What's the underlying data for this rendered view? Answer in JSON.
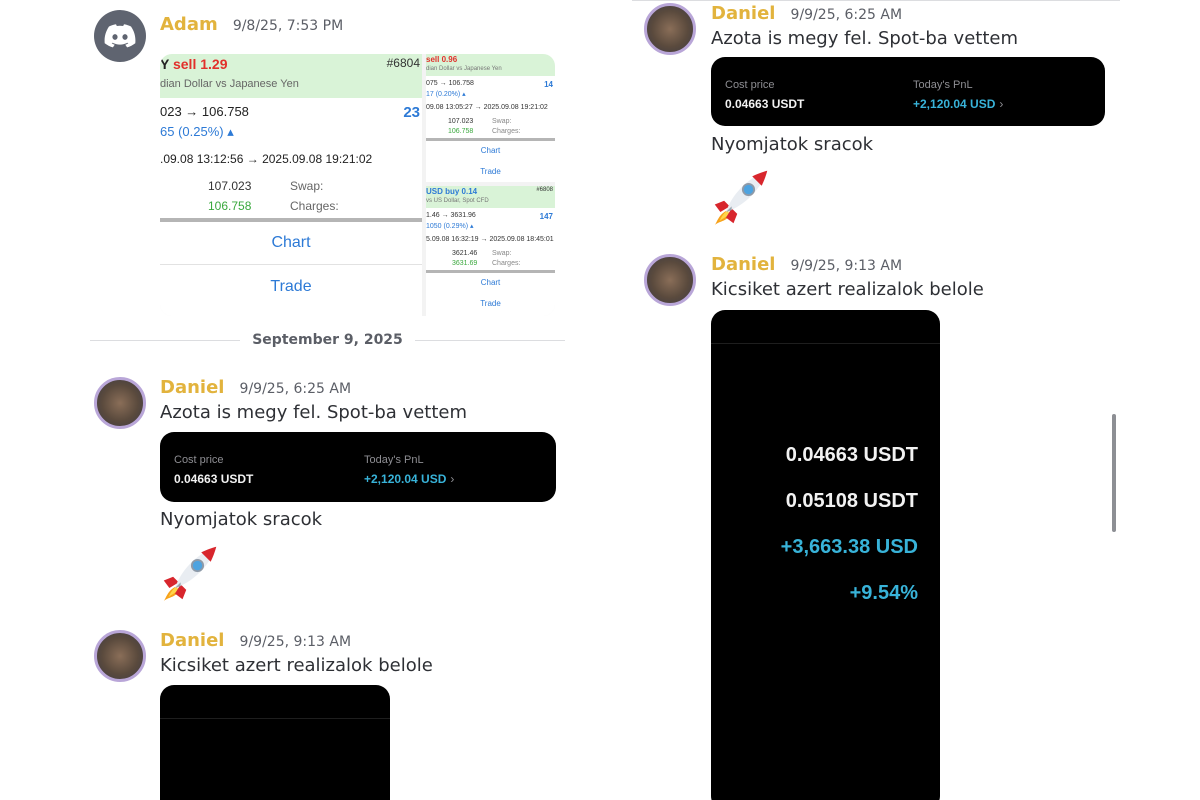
{
  "date_divider": "September 9, 2025",
  "left": {
    "adam": {
      "username": "Adam",
      "timestamp": "9/8/25, 7:53 PM",
      "trade_main": {
        "symbol_prefix": "Y",
        "side": "sell 1.29",
        "ticket": "#6804",
        "instrument": "dian Dollar vs Japanese Yen",
        "price_change": "023 → 106.758",
        "pct": "65 (0.25%) ▴",
        "big_number": "23",
        "dates": ".09.08 13:12:56 → 2025.09.08 19:21:02",
        "open_price": "107.023",
        "close_price": "106.758",
        "swap_label": "Swap:",
        "charges_label": "Charges:",
        "chart_label": "Chart",
        "trade_label": "Trade"
      },
      "trade_small_a": {
        "side": "sell 0.96",
        "instrument": "dian Dollar vs Japanese Yen",
        "price_change": "075 → 106.758",
        "pct": "17 (0.20%) ▴",
        "right_num": "14",
        "dates": "09.08 13:05:27 → 2025.09.08 19:21:02",
        "open_price": "107.023",
        "close_price": "106.758",
        "swap_label": "Swap:",
        "charges_label": "Charges:",
        "chart_label": "Chart",
        "trade_label": "Trade"
      },
      "trade_small_b": {
        "side": "USD buy 0.14",
        "ticket": "#6808",
        "instrument": "vs US Dollar, Spot CFD",
        "price_change": "1.46 → 3631.96",
        "pct": "1050 (0.29%) ▴",
        "right_num": "147",
        "dates": "5.09.08 16:32:19 → 2025.09.08 18:45:01",
        "open_price": "3621.46",
        "close_price": "3631.69",
        "swap_label": "Swap:",
        "charges_label": "Charges:",
        "chart_label": "Chart",
        "trade_label": "Trade"
      }
    },
    "daniel1": {
      "username": "Daniel",
      "timestamp": "9/9/25, 6:25 AM",
      "text": "Azota is megy fel. Spot-ba vettem",
      "cost_label": "Cost price",
      "cost_value": "0.04663 USDT",
      "pnl_label": "Today's PnL",
      "pnl_value": "+2,120.04 USD",
      "chevron": "›",
      "text2": "Nyomjatok sracok"
    },
    "daniel2": {
      "username": "Daniel",
      "timestamp": "9/9/25, 9:13 AM",
      "text": "Kicsiket azert realizalok belole"
    }
  },
  "right": {
    "daniel1": {
      "username": "Daniel",
      "timestamp": "9/9/25, 6:25 AM",
      "text": "Azota is megy fel. Spot-ba vettem",
      "cost_label": "Cost price",
      "cost_value": "0.04663 USDT",
      "pnl_label": "Today's PnL",
      "pnl_value": "+2,120.04 USD",
      "chevron": "›",
      "text2": "Nyomjatok sracok"
    },
    "daniel2": {
      "username": "Daniel",
      "timestamp": "9/9/25, 9:13 AM",
      "text": "Kicsiket azert realizalok belole",
      "values": {
        "cost": "0.04663 USDT",
        "current": "0.05108 USDT",
        "pnl": "+3,663.38 USD",
        "pct": "+9.54%"
      }
    }
  },
  "icons": {
    "discord": "discord-logo-icon",
    "rocket": "rocket-emoji"
  },
  "colors": {
    "username": "#e2b33d",
    "pnl_cyan": "#38b3d9",
    "sell_red": "#e2302b",
    "link_blue": "#2d7ad6"
  }
}
